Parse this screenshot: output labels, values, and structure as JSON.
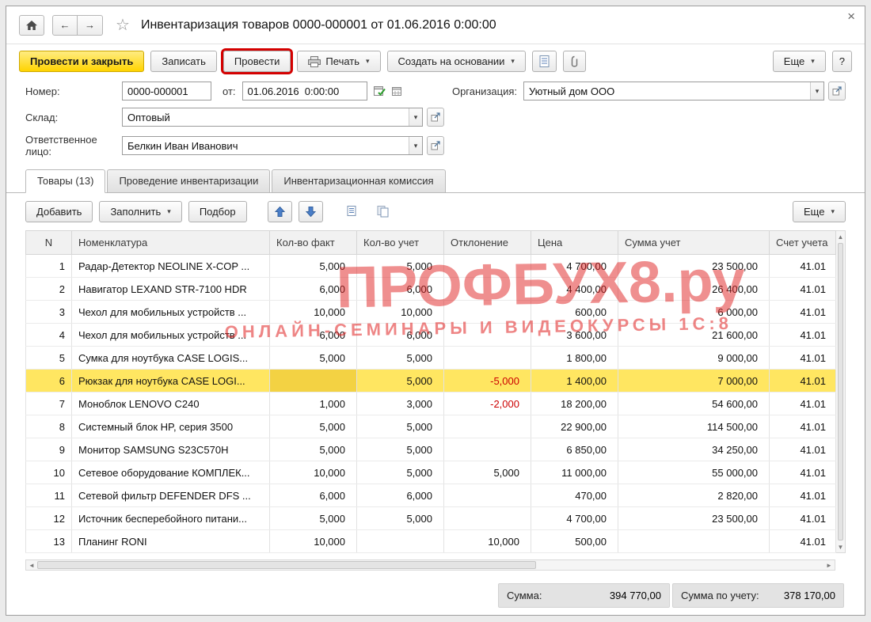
{
  "window": {
    "title": "Инвентаризация товаров 0000-000001 от 01.06.2016 0:00:00"
  },
  "icons": {
    "back": "←",
    "forward": "→",
    "star": "☆",
    "close": "×",
    "dropdown": "▾",
    "up": "▲",
    "down": "▼",
    "left": "◄",
    "right": "►"
  },
  "toolbar": {
    "post_close": "Провести и закрыть",
    "write": "Записать",
    "post": "Провести",
    "print": "Печать",
    "create_based_on": "Создать на основании",
    "more": "Еще",
    "help": "?"
  },
  "form": {
    "number_label": "Номер:",
    "number_value": "0000-000001",
    "date_label": "от:",
    "date_value": "01.06.2016  0:00:00",
    "org_label": "Организация:",
    "org_value": "Уютный дом ООО",
    "warehouse_label": "Склад:",
    "warehouse_value": "Оптовый",
    "person_label": "Ответственное лицо:",
    "person_value": "Белкин Иван Иванович"
  },
  "tabs": [
    {
      "label": "Товары (13)",
      "active": true
    },
    {
      "label": "Проведение инвентаризации",
      "active": false
    },
    {
      "label": "Инвентаризационная комиссия",
      "active": false
    }
  ],
  "table_toolbar": {
    "add": "Добавить",
    "fill": "Заполнить",
    "pick": "Подбор",
    "more": "Еще"
  },
  "table": {
    "columns": [
      "N",
      "Номенклатура",
      "Кол-во факт",
      "Кол-во учет",
      "Отклонение",
      "Цена",
      "Сумма учет",
      "Счет учета"
    ],
    "rows": [
      {
        "n": "1",
        "name": "Радар-Детектор NEOLINE X-COP ...",
        "fact": "5,000",
        "qty": "5,000",
        "dev": "",
        "price": "4 700,00",
        "sum": "23 500,00",
        "account": "41.01"
      },
      {
        "n": "2",
        "name": "Навигатор LEXAND STR-7100 HDR",
        "fact": "6,000",
        "qty": "6,000",
        "dev": "",
        "price": "4 400,00",
        "sum": "26 400,00",
        "account": "41.01"
      },
      {
        "n": "3",
        "name": "Чехол для мобильных устройств ...",
        "fact": "10,000",
        "qty": "10,000",
        "dev": "",
        "price": "600,00",
        "sum": "6 000,00",
        "account": "41.01"
      },
      {
        "n": "4",
        "name": "Чехол для мобильных устройств ...",
        "fact": "6,000",
        "qty": "6,000",
        "dev": "",
        "price": "3 600,00",
        "sum": "21 600,00",
        "account": "41.01"
      },
      {
        "n": "5",
        "name": "Сумка для ноутбука CASE LOGIS...",
        "fact": "5,000",
        "qty": "5,000",
        "dev": "",
        "price": "1 800,00",
        "sum": "9 000,00",
        "account": "41.01"
      },
      {
        "n": "6",
        "name": "Рюкзак для ноутбука CASE LOGI...",
        "fact": "",
        "qty": "5,000",
        "dev": "-5,000",
        "price": "1 400,00",
        "sum": "7 000,00",
        "account": "41.01",
        "selected": true,
        "active_cell": "fact"
      },
      {
        "n": "7",
        "name": "Моноблок LENOVO C240",
        "fact": "1,000",
        "qty": "3,000",
        "dev": "-2,000",
        "price": "18 200,00",
        "sum": "54 600,00",
        "account": "41.01"
      },
      {
        "n": "8",
        "name": "Системный блок HP, серия 3500",
        "fact": "5,000",
        "qty": "5,000",
        "dev": "",
        "price": "22 900,00",
        "sum": "114 500,00",
        "account": "41.01"
      },
      {
        "n": "9",
        "name": "Монитор SAMSUNG S23C570H",
        "fact": "5,000",
        "qty": "5,000",
        "dev": "",
        "price": "6 850,00",
        "sum": "34 250,00",
        "account": "41.01"
      },
      {
        "n": "10",
        "name": "Сетевое оборудование КОМПЛЕК...",
        "fact": "10,000",
        "qty": "5,000",
        "dev": "5,000",
        "price": "11 000,00",
        "sum": "55 000,00",
        "account": "41.01"
      },
      {
        "n": "11",
        "name": "Сетевой фильтр DEFENDER DFS ...",
        "fact": "6,000",
        "qty": "6,000",
        "dev": "",
        "price": "470,00",
        "sum": "2 820,00",
        "account": "41.01"
      },
      {
        "n": "12",
        "name": "Источник бесперебойного питани...",
        "fact": "5,000",
        "qty": "5,000",
        "dev": "",
        "price": "4 700,00",
        "sum": "23 500,00",
        "account": "41.01"
      },
      {
        "n": "13",
        "name": "Планинг RONI",
        "fact": "10,000",
        "qty": "",
        "dev": "10,000",
        "price": "500,00",
        "sum": "",
        "account": "41.01"
      }
    ]
  },
  "footer": {
    "sum_label": "Сумма:",
    "sum_value": "394 770,00",
    "sum_acct_label": "Сумма по учету:",
    "sum_acct_value": "378 170,00"
  },
  "watermark": {
    "line1": "ПРОФБУХ8.ру",
    "line2": "ОНЛАЙН-СЕМИНАРЫ И ВИДЕОКУРСЫ 1С:8"
  },
  "colors": {
    "accent_yellow": "#ffd400",
    "selected_row": "#ffe661",
    "negative": "#cc0000",
    "watermark_red": "#e02020",
    "highlight_border": "#d40000"
  }
}
